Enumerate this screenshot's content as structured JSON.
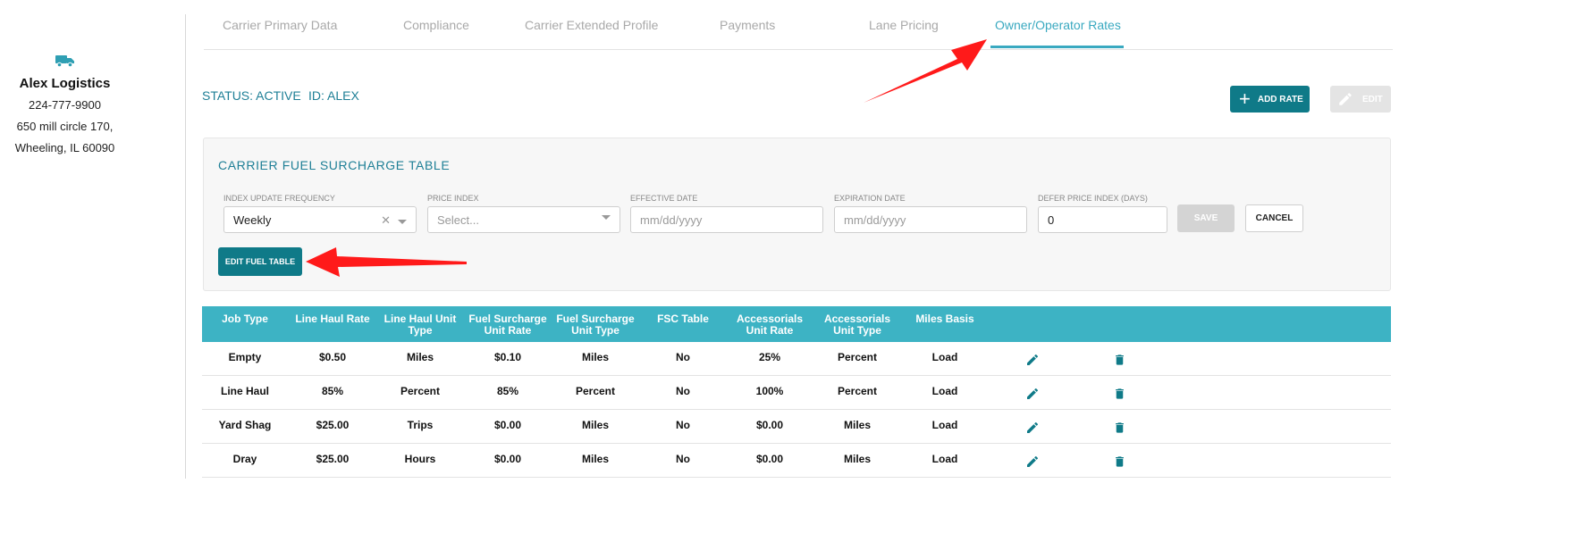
{
  "carrier": {
    "icon": "truck-icon",
    "name": "Alex Logistics",
    "phone": "224-777-9900",
    "address_line1": "650 mill circle 170,",
    "address_line2": "Wheeling, IL 60090"
  },
  "tabs": [
    {
      "label": "Carrier Primary Data",
      "active": false
    },
    {
      "label": "Compliance",
      "active": false
    },
    {
      "label": "Carrier Extended Profile",
      "active": false
    },
    {
      "label": "Payments",
      "active": false
    },
    {
      "label": "Lane Pricing",
      "active": false
    },
    {
      "label": "Owner/Operator Rates",
      "active": true
    }
  ],
  "status": {
    "status_text": "STATUS: ACTIVE",
    "id_text": "ID: ALEX"
  },
  "toolbar": {
    "add_rate_label": "ADD RATE",
    "edit_label": "EDIT"
  },
  "fuel_panel": {
    "title": "CARRIER FUEL SURCHARGE TABLE",
    "fields": {
      "frequency": {
        "label": "INDEX UPDATE FREQUENCY",
        "value": "Weekly"
      },
      "price_index": {
        "label": "PRICE INDEX",
        "placeholder": "Select..."
      },
      "effective_date": {
        "label": "EFFECTIVE DATE",
        "placeholder": "mm/dd/yyyy"
      },
      "expiration_date": {
        "label": "EXPIRATION DATE",
        "placeholder": "mm/dd/yyyy"
      },
      "defer_days": {
        "label": "DEFER PRICE INDEX (DAYS)",
        "value": "0"
      }
    },
    "save_label": "SAVE",
    "cancel_label": "CANCEL",
    "edit_fuel_label": "EDIT FUEL TABLE"
  },
  "table": {
    "headers": [
      "Job Type",
      "Line Haul Rate",
      "Line Haul Unit Type",
      "Fuel Surcharge Unit Rate",
      "Fuel Surcharge Unit Type",
      "FSC Table",
      "Accessorials Unit Rate",
      "Accessorials Unit Type",
      "Miles Basis"
    ],
    "rows": [
      [
        "Empty",
        "$0.50",
        "Miles",
        "$0.10",
        "Miles",
        "No",
        "25%",
        "Percent",
        "Load"
      ],
      [
        "Line Haul",
        "85%",
        "Percent",
        "85%",
        "Percent",
        "No",
        "100%",
        "Percent",
        "Load"
      ],
      [
        "Yard Shag",
        "$25.00",
        "Trips",
        "$0.00",
        "Miles",
        "No",
        "$0.00",
        "Miles",
        "Load"
      ],
      [
        "Dray",
        "$25.00",
        "Hours",
        "$0.00",
        "Miles",
        "No",
        "$0.00",
        "Miles",
        "Load"
      ]
    ],
    "row_icons": {
      "edit": "pencil-icon",
      "delete": "trash-icon"
    }
  },
  "colors": {
    "accent": "#3aa9c0",
    "brand_dark": "#0f7a88",
    "table_header": "#3db3c4",
    "annotation_arrow": "#ff1a1a"
  }
}
